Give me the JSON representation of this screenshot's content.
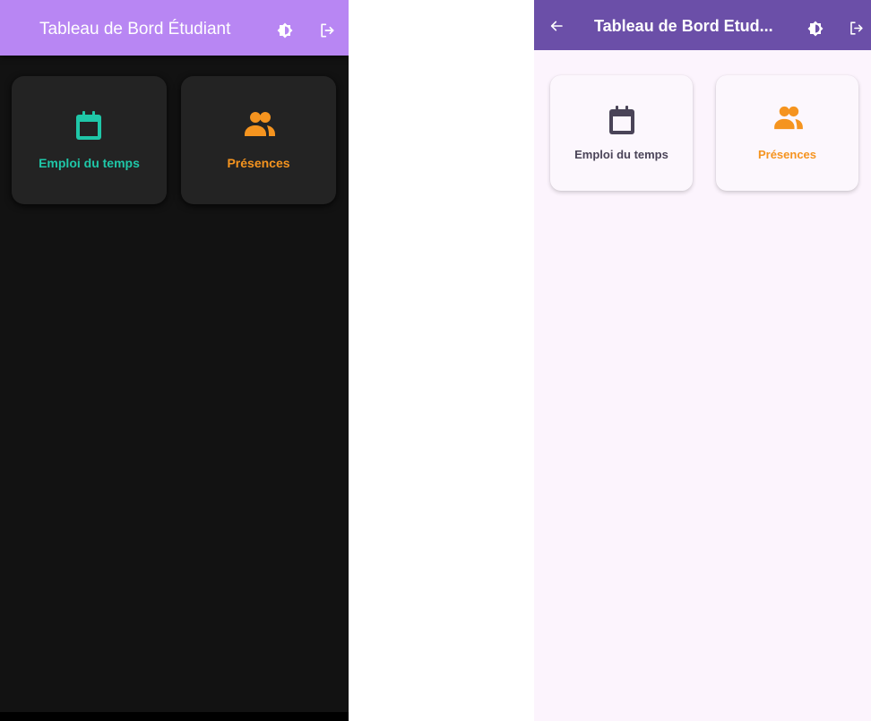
{
  "dark_screen": {
    "appbar": {
      "title": "Tableau de Bord Étudiant",
      "background": "#b886f3",
      "actions": [
        "contrast-icon",
        "logout-icon"
      ]
    },
    "background": "#121212",
    "cards": [
      {
        "label": "Emploi du temps",
        "icon": "calendar-icon",
        "color": "#1fc7a8"
      },
      {
        "label": "Présences",
        "icon": "people-icon",
        "color": "#f5941f"
      }
    ]
  },
  "light_screen": {
    "appbar": {
      "title": "Tableau de Bord Etud...",
      "background": "#6b4fa8",
      "actions": [
        "back-arrow-icon",
        "contrast-icon",
        "logout-icon"
      ]
    },
    "background": "#fcf4fd",
    "cards": [
      {
        "label": "Emploi du temps",
        "icon": "calendar-icon",
        "color": "#4a4458"
      },
      {
        "label": "Présences",
        "icon": "people-icon",
        "color": "#f5941f"
      }
    ]
  }
}
